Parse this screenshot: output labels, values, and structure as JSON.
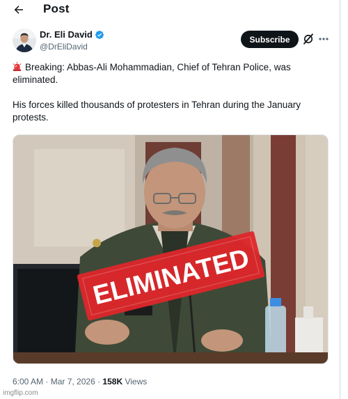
{
  "header": {
    "title": "Post",
    "back_icon": "arrow-left-icon"
  },
  "author": {
    "name": "Dr. Eli David",
    "handle": "@DrEliDavid",
    "verified_icon": "verified-badge-icon",
    "verified_color": "#1d9bf0"
  },
  "actions": {
    "subscribe_label": "Subscribe",
    "grok_icon": "grok-icon",
    "more_icon": "more-icon"
  },
  "tweet": {
    "emoji": "rotating-light-icon",
    "line1": "Breaking: Abbas-Ali Mohammadian, Chief of Tehran Police, was eliminated.",
    "line2": "His forces killed thousands of protesters in Tehran during the January protests."
  },
  "media": {
    "stamp_text": "ELIMINATED",
    "stamp_color": "#e0262b"
  },
  "meta": {
    "time": "6:00 AM",
    "separator1": " · ",
    "date": "Mar 7, 2026",
    "separator2": " · ",
    "views_count": "158K",
    "views_label": " Views"
  },
  "watermark": "imgflip.com"
}
